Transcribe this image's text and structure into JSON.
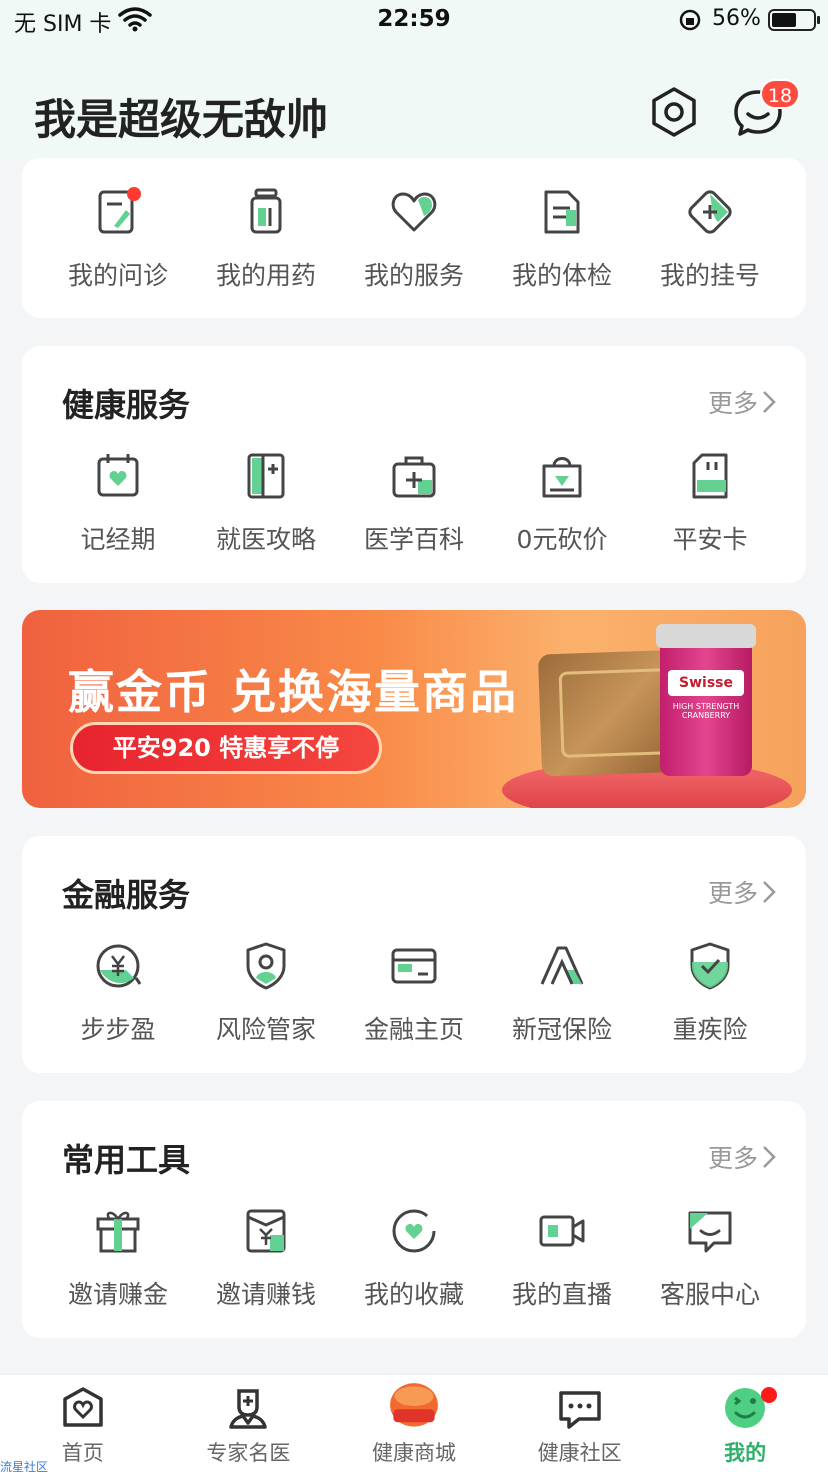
{
  "status": {
    "carrier": "无 SIM 卡",
    "time": "22:59",
    "battery": "56%"
  },
  "header": {
    "title": "我是超级无敌帅",
    "msg_badge": "18"
  },
  "medical": {
    "items": [
      {
        "label": "我的问诊",
        "icon": "consult-icon"
      },
      {
        "label": "我的用药",
        "icon": "medicine-icon"
      },
      {
        "label": "我的服务",
        "icon": "heart-icon"
      },
      {
        "label": "我的体检",
        "icon": "checkup-icon"
      },
      {
        "label": "我的挂号",
        "icon": "registration-icon"
      }
    ]
  },
  "health": {
    "title": "健康服务",
    "more": "更多",
    "items": [
      {
        "label": "记经期",
        "icon": "calendar-icon"
      },
      {
        "label": "就医攻略",
        "icon": "guide-icon"
      },
      {
        "label": "医学百科",
        "icon": "medkit-icon"
      },
      {
        "label": "0元砍价",
        "icon": "shopping-bag-icon"
      },
      {
        "label": "平安卡",
        "icon": "sim-card-icon"
      }
    ]
  },
  "banner": {
    "headline": "赢金币 兑换海量商品",
    "pill": "平安920 特惠享不停",
    "product_brand": "Swisse",
    "product_name": "HIGH STRENGTH CRANBERRY"
  },
  "finance": {
    "title": "金融服务",
    "more": "更多",
    "items": [
      {
        "label": "步步盈",
        "icon": "yen-coin-icon"
      },
      {
        "label": "风险管家",
        "icon": "shield-user-icon"
      },
      {
        "label": "金融主页",
        "icon": "card-icon"
      },
      {
        "label": "新冠保险",
        "icon": "insurance-a-icon"
      },
      {
        "label": "重疾险",
        "icon": "shield-check-icon"
      }
    ]
  },
  "tools": {
    "title": "常用工具",
    "more": "更多",
    "items": [
      {
        "label": "邀请赚金",
        "icon": "gift-icon"
      },
      {
        "label": "邀请赚钱",
        "icon": "envelope-yen-icon"
      },
      {
        "label": "我的收藏",
        "icon": "favorite-icon"
      },
      {
        "label": "我的直播",
        "icon": "video-icon"
      },
      {
        "label": "客服中心",
        "icon": "support-chat-icon"
      }
    ]
  },
  "tabbar": {
    "items": [
      {
        "label": "首页"
      },
      {
        "label": "专家名医"
      },
      {
        "label": "健康商城",
        "badge": "大放价"
      },
      {
        "label": "健康社区"
      },
      {
        "label": "我的"
      }
    ]
  },
  "watermark": "流星社区",
  "colors": {
    "accent": "#2fb06a",
    "icon_stroke": "#444444",
    "icon_fill": "#62d191",
    "badge": "#ff4b3e"
  }
}
